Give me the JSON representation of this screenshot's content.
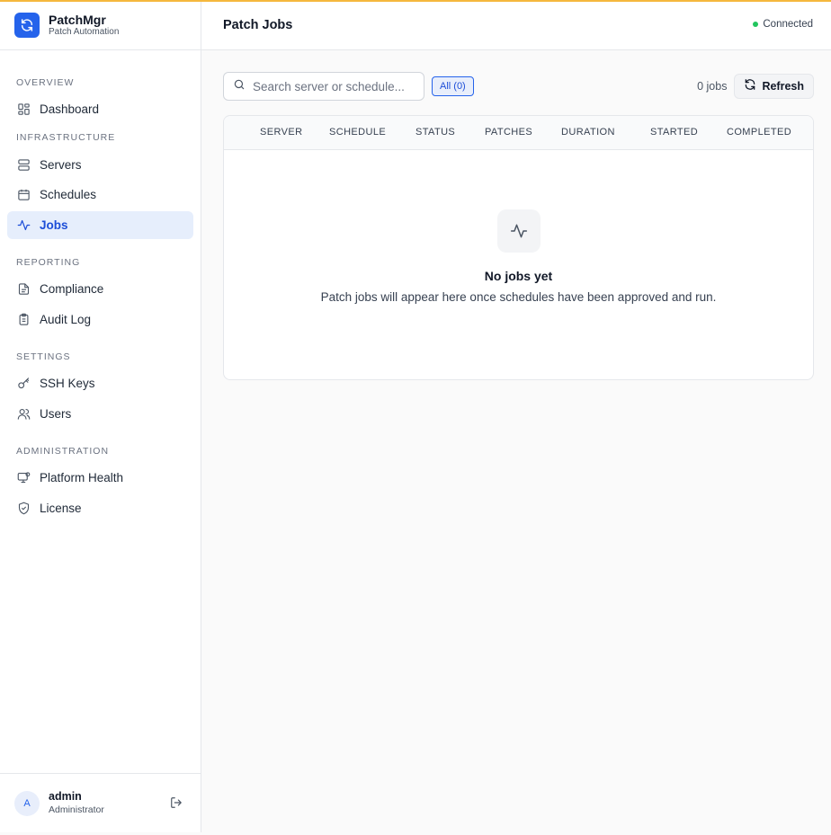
{
  "brand": {
    "name": "PatchMgr",
    "subtitle": "Patch Automation",
    "accent": "#2563eb"
  },
  "sidebar": {
    "sections": [
      {
        "label": "OVERVIEW",
        "items": [
          {
            "label": "Dashboard",
            "icon": "dashboard-grid-icon"
          }
        ]
      },
      {
        "label": "INFRASTRUCTURE",
        "items": [
          {
            "label": "Servers",
            "icon": "server-icon"
          },
          {
            "label": "Schedules",
            "icon": "calendar-icon"
          },
          {
            "label": "Jobs",
            "icon": "activity-icon",
            "active": true
          }
        ]
      },
      {
        "label": "REPORTING",
        "items": [
          {
            "label": "Compliance",
            "icon": "document-icon"
          },
          {
            "label": "Audit Log",
            "icon": "clipboard-icon"
          }
        ]
      },
      {
        "label": "SETTINGS",
        "items": [
          {
            "label": "SSH Keys",
            "icon": "key-icon"
          },
          {
            "label": "Users",
            "icon": "users-icon"
          }
        ]
      },
      {
        "label": "ADMINISTRATION",
        "items": [
          {
            "label": "Platform Health",
            "icon": "monitor-icon"
          },
          {
            "label": "License",
            "icon": "shield-check-icon"
          }
        ]
      }
    ]
  },
  "user": {
    "initial": "A",
    "name": "admin",
    "role": "Administrator"
  },
  "header": {
    "title": "Patch Jobs",
    "status": "Connected",
    "status_color": "#22c55e"
  },
  "toolbar": {
    "search_placeholder": "Search server or schedule...",
    "filter_label": "All (0)",
    "count_label": "0 jobs",
    "refresh_label": "Refresh"
  },
  "table": {
    "columns": [
      "SERVER",
      "SCHEDULE",
      "STATUS",
      "PATCHES",
      "DURATION",
      "STARTED",
      "COMPLETED"
    ],
    "rows": []
  },
  "empty_state": {
    "title": "No jobs yet",
    "description": "Patch jobs will appear here once schedules have been approved and run."
  }
}
